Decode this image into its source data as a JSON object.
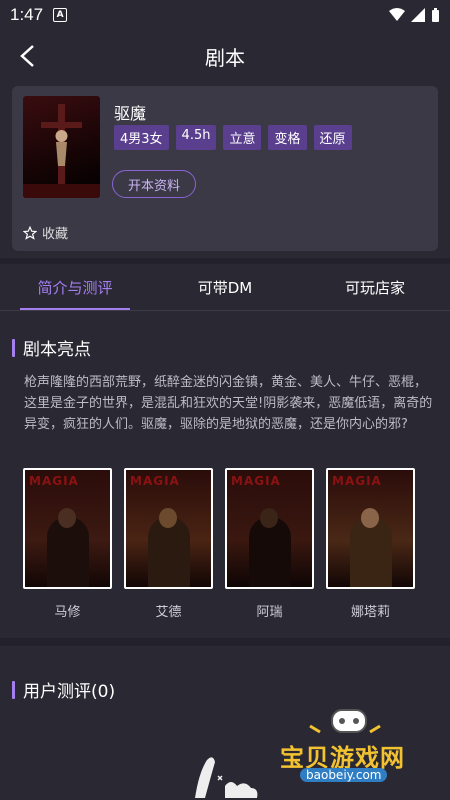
{
  "status": {
    "time": "1:47",
    "a_badge": "A"
  },
  "header": {
    "title": "剧本"
  },
  "script": {
    "name": "驱魔",
    "tags": [
      "4男3女",
      "4.5h",
      "立意",
      "变格",
      "还原"
    ],
    "open_button": "开本资料",
    "favorite": "收藏"
  },
  "tabs": [
    {
      "label": "简介与测评",
      "active": true
    },
    {
      "label": "可带DM",
      "active": false
    },
    {
      "label": "可玩店家",
      "active": false
    }
  ],
  "highlights": {
    "title": "剧本亮点",
    "description": "枪声隆隆的西部荒野，纸醉金迷的闪金镇，黄金、美人、牛仔、恶棍，这里是金子的世界，是混乱和狂欢的天堂!阴影袭来，恶魔低语，离奇的异变，疯狂的人们。驱魔，驱除的是地狱的恶魔，还是你内心的邪?"
  },
  "characters": [
    {
      "name": "马修",
      "pic_text": "MAGIA"
    },
    {
      "name": "艾德",
      "pic_text": "MAGIA"
    },
    {
      "name": "阿瑞",
      "pic_text": "MAGIA"
    },
    {
      "name": "娜塔莉",
      "pic_text": "MAGIA"
    }
  ],
  "reviews": {
    "title": "用户测评(0)"
  },
  "watermark": {
    "text": "宝贝游戏网",
    "url": "baobeiy.com"
  },
  "colors": {
    "accent": "#a57ef0",
    "tag_bg": "#5b3f8f",
    "background": "#2a2833",
    "card": "#3b3946"
  }
}
